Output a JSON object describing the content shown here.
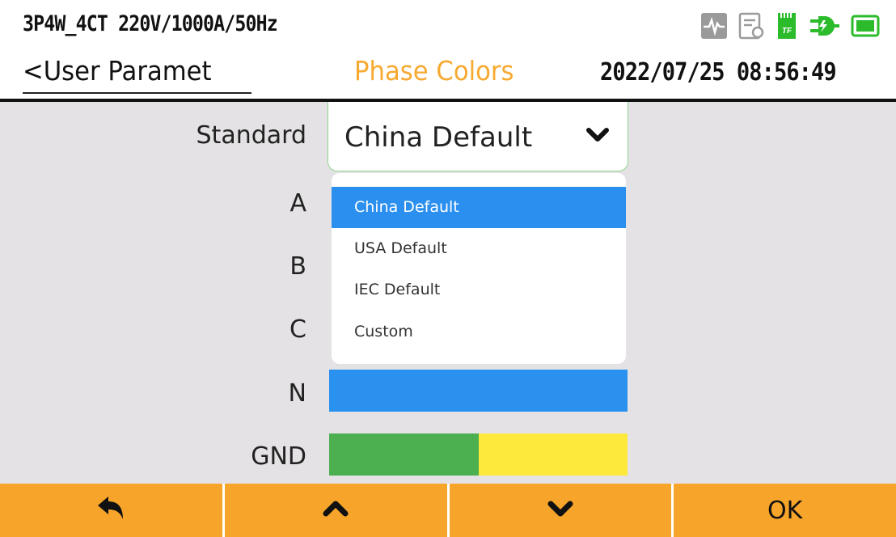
{
  "header": {
    "config": "3P4W_4CT 220V/1000A/50Hz",
    "back_label": "<User Paramet",
    "title": "Phase Colors",
    "datetime": "2022/07/25 08:56:49",
    "icons": [
      "waveform-icon",
      "record-icon",
      "tf-card-icon",
      "power-plug-icon",
      "battery-icon"
    ],
    "tf_label": "TF"
  },
  "form": {
    "standard_label": "Standard",
    "standard_value": "China Default",
    "options": [
      "China Default",
      "USA Default",
      "IEC Default",
      "Custom"
    ],
    "selected_index": 0,
    "phases": [
      {
        "label": "A"
      },
      {
        "label": "B"
      },
      {
        "label": "C"
      },
      {
        "label": "N",
        "color": "#2a91ef"
      },
      {
        "label": "GND",
        "colors": [
          "#4caf50",
          "#fde93b"
        ]
      }
    ]
  },
  "footer": {
    "buttons": [
      "back-arrow-icon",
      "up-chevron-icon",
      "down-chevron-icon",
      "OK"
    ],
    "ok_label": "OK"
  },
  "colors": {
    "accent": "#f7a42a",
    "title": "#f7a930",
    "selection": "#2a8fef",
    "icon_gray": "#9a9a9a",
    "icon_green": "#2bbb2b"
  }
}
